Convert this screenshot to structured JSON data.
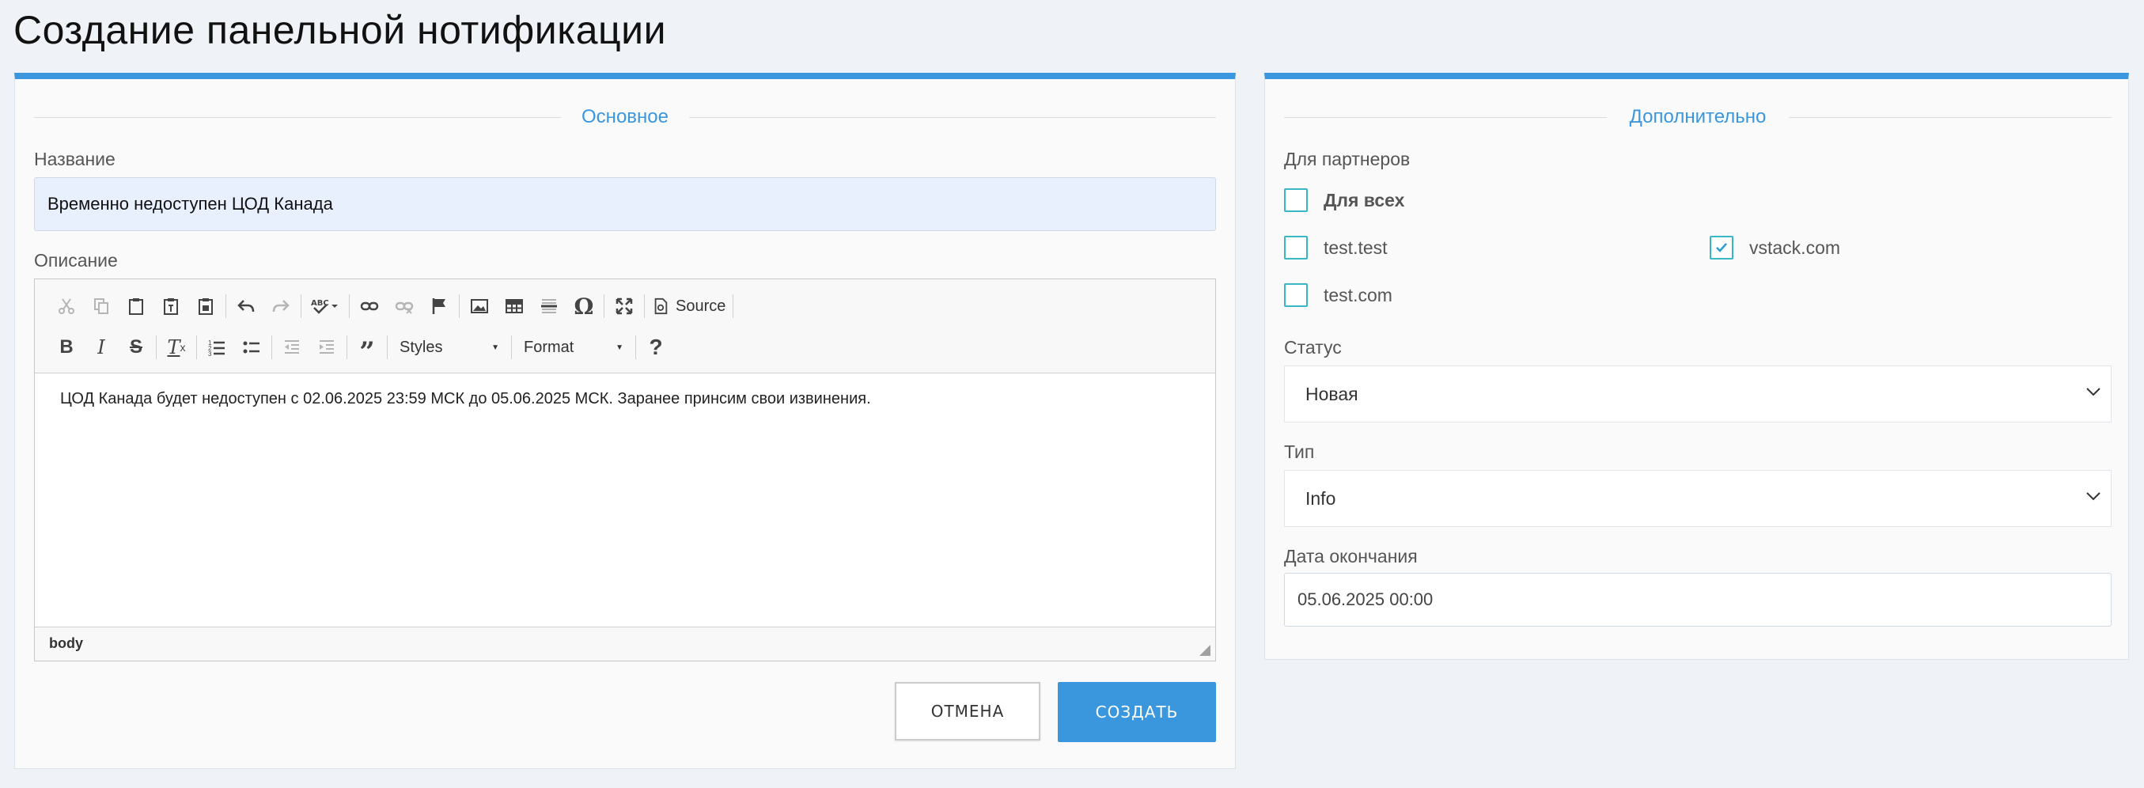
{
  "page": {
    "title": "Создание панельной нотификации"
  },
  "main": {
    "legend": "Основное",
    "name_label": "Название",
    "name_value": "Временно недоступен ЦОД Канада",
    "description_label": "Описание",
    "toolbar": {
      "source_label": "Source",
      "styles_label": "Styles",
      "format_label": "Format"
    },
    "editor_text": "ЦОД Канада будет недоступен с 02.06.2025 23:59 МСК до 05.06.2025 МСК. Заранее принсим свои извинения.",
    "footer_path": "body",
    "cancel_label": "ОТМЕНА",
    "create_label": "СОЗДАТЬ"
  },
  "extra": {
    "legend": "Дополнительно",
    "partners_label": "Для партнеров",
    "partners": [
      {
        "label": "Для всех",
        "checked": false
      },
      {
        "label": "test.test",
        "checked": false
      },
      {
        "label": "vstack.com",
        "checked": true
      },
      {
        "label": "test.com",
        "checked": false
      }
    ],
    "status_label": "Статус",
    "status_value": "Новая",
    "type_label": "Тип",
    "type_value": "Info",
    "end_date_label": "Дата окончания",
    "end_date_value": "05.06.2025 00:00"
  },
  "colors": {
    "accent": "#3a96dd",
    "checkbox": "#3ab7c7"
  }
}
